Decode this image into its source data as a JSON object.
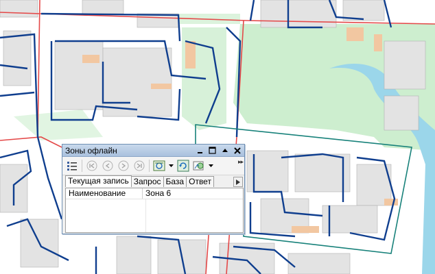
{
  "colors": {
    "map_background": "#ffffff",
    "green_area": "#cdeecf",
    "building": "#e2e2e2",
    "building_accent": "#f2c7a1",
    "network_line": "#0f3e8e",
    "road_line": "#e44848",
    "water": "#9bd6ea",
    "zone_outline": "#17817a",
    "window_title_bar": "#b5cbe4"
  },
  "window": {
    "title": "Зоны офлайн",
    "title_buttons": [
      "minimize-icon",
      "maximize-icon",
      "collapse-up-icon",
      "close-icon"
    ],
    "toolbar_icons": [
      "list-view-icon",
      "first-record-icon",
      "previous-record-icon",
      "next-record-icon",
      "last-record-icon",
      "filter-icon",
      "refresh-icon",
      "zone-map-icon"
    ],
    "tabs": [
      {
        "label": "Текущая запись",
        "active": true
      },
      {
        "label": "Запрос",
        "active": false
      },
      {
        "label": "База",
        "active": false
      },
      {
        "label": "Ответ",
        "active": false
      }
    ],
    "table": {
      "rows": [
        {
          "name": "Наименование",
          "value": "Зона 6"
        }
      ]
    }
  }
}
